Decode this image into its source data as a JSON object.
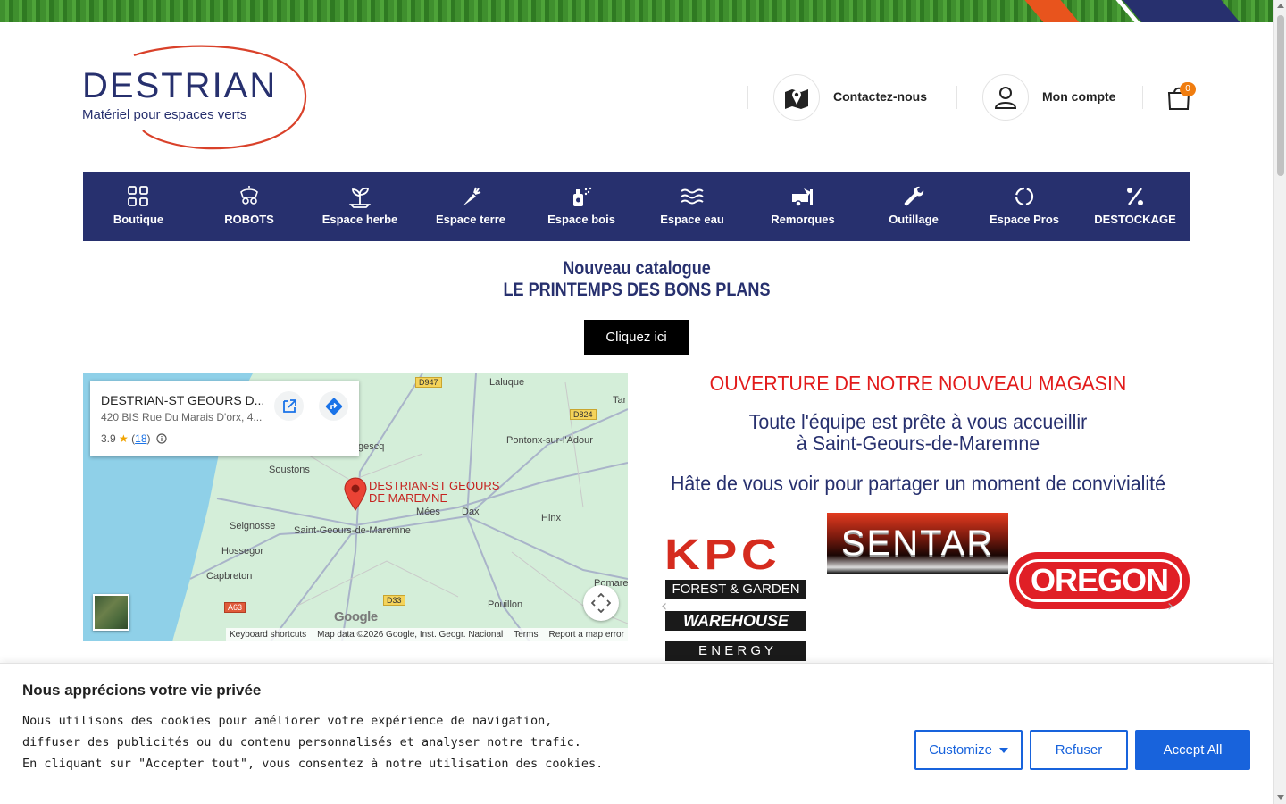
{
  "header": {
    "logo_name": "DESTRIAN",
    "logo_tagline": "Matériel pour espaces verts",
    "contact_label": "Contactez-nous",
    "account_label": "Mon compte",
    "cart_count": "0"
  },
  "nav": {
    "items": [
      {
        "label": "Boutique",
        "icon": "grid-icon"
      },
      {
        "label": "ROBOTS",
        "icon": "robot-mower-icon"
      },
      {
        "label": "Espace herbe",
        "icon": "sprout-icon"
      },
      {
        "label": "Espace terre",
        "icon": "carrot-icon"
      },
      {
        "label": "Espace bois",
        "icon": "spray-icon"
      },
      {
        "label": "Espace eau",
        "icon": "waves-icon"
      },
      {
        "label": "Remorques",
        "icon": "trailer-icon"
      },
      {
        "label": "Outillage",
        "icon": "wrench-icon"
      },
      {
        "label": "Espace Pros",
        "icon": "loader-icon"
      },
      {
        "label": "DESTOCKAGE",
        "icon": "percent-icon"
      }
    ]
  },
  "promo": {
    "line1": "Nouveau catalogue",
    "line2": "LE PRINTEMPS DES BONS PLANS",
    "cta": "Cliquez ici"
  },
  "map": {
    "place_name": "DESTRIAN-ST GEOURS D...",
    "address": "420 BIS Rue Du Marais D'orx, 4...",
    "rating": "3.9",
    "review_count": "18",
    "pin_label_1": "DESTRIAN-ST GEOURS",
    "pin_label_2": "DE MAREMNE",
    "towns": {
      "laluque": "Laluque",
      "tar": "Tar",
      "gescq": "gescq",
      "pontonx": "Pontonx-sur-l'Adour",
      "soustons": "Soustons",
      "mees": "Mées",
      "dax": "Dax",
      "seignosse": "Seignosse",
      "saint_geours": "Saint-Geours-de-Maremne",
      "hinx": "Hinx",
      "hossegor": "Hossegor",
      "capbreton": "Capbreton",
      "pomare": "Pomare",
      "pouillon": "Pouillon"
    },
    "roads": {
      "d947": "D947",
      "d824": "D824",
      "d33": "D33",
      "a63": "A63"
    },
    "google": "Google",
    "footer": {
      "shortcuts": "Keyboard shortcuts",
      "data": "Map data ©2026 Google, Inst. Geogr. Nacional",
      "terms": "Terms",
      "report": "Report a map error"
    }
  },
  "store": {
    "opening": "OUVERTURE DE NOTRE NOUVEAU MAGASIN",
    "welcome_1": "Toute l'équipe est prête à vous accueillir",
    "welcome_2": "à Saint-Geours-de-Maremne",
    "hate": "Hâte de vous voir pour partager un moment de convivialité"
  },
  "brands": {
    "kpc": "KPC",
    "kpc_band_1": "FOREST & GARDEN",
    "kpc_band_2": "WAREHOUSE",
    "kpc_band_3": "E N E R G Y",
    "sentar": "SENTAR",
    "oregon": "OREGON",
    "prev": "‹",
    "next": "›"
  },
  "cookie": {
    "title": "Nous apprécions votre vie privée",
    "line1": "Nous utilisons des cookies pour améliorer votre expérience de navigation,",
    "line2": "diffuser des publicités ou du contenu personnalisés et analyser notre trafic.",
    "line3": "En cliquant sur \"Accepter tout\", vous consentez à notre utilisation des cookies.",
    "customize": "Customize",
    "refuse": "Refuser",
    "accept": "Accept All"
  },
  "colors": {
    "brand_navy": "#27306e",
    "accent_orange": "#f07d0f",
    "alert_red": "#e21b1b",
    "cookie_blue": "#1863dc"
  }
}
